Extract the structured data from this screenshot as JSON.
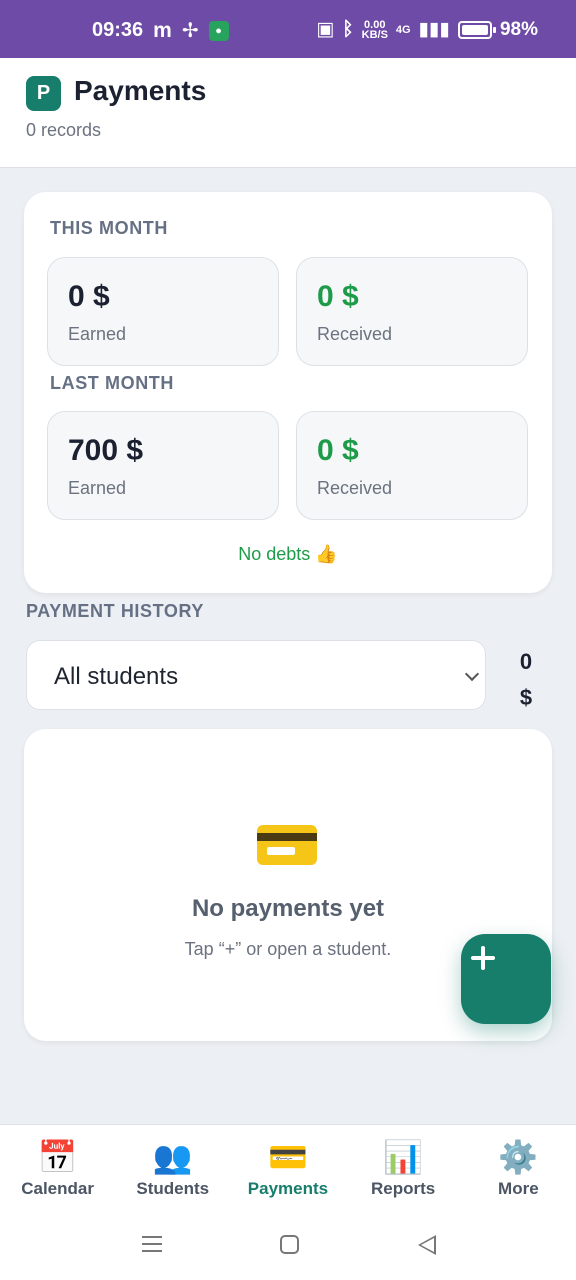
{
  "status_bar": {
    "time": "09:36",
    "carrier_glyph": "m",
    "net_speed_value": "0.00",
    "net_speed_unit": "KB/S",
    "network_type": "4G",
    "battery": "98%"
  },
  "header": {
    "logo_letter": "P",
    "title": "Payments",
    "record_count": "0 records"
  },
  "summary": {
    "this_month": {
      "label": "THIS MONTH",
      "earned_value": "0 $",
      "earned_caption": "Earned",
      "received_value": "0 $",
      "received_caption": "Received"
    },
    "last_month": {
      "label": "LAST MONTH",
      "earned_value": "700 $",
      "earned_caption": "Earned",
      "received_value": "0 $",
      "received_caption": "Received"
    },
    "debt_status": "No debts 👍"
  },
  "history": {
    "label": "PAYMENT HISTORY",
    "filter_selected": "All students",
    "total_amount": "0",
    "total_currency": "$"
  },
  "empty_state": {
    "icon": "credit-card-icon",
    "title": "No payments yet",
    "hint": "Tap “+” or open a student."
  },
  "fab": {
    "icon": "plus-icon"
  },
  "bottom_nav": {
    "items": [
      {
        "label": "Calendar",
        "icon": "📅",
        "icon_name": "calendar-icon"
      },
      {
        "label": "Students",
        "icon": "👥",
        "icon_name": "students-icon"
      },
      {
        "label": "Payments",
        "icon": "💳",
        "icon_name": "payments-icon"
      },
      {
        "label": "Reports",
        "icon": "📊",
        "icon_name": "reports-icon"
      },
      {
        "label": "More",
        "icon": "⚙️",
        "icon_name": "gear-icon"
      }
    ],
    "active_index": 2
  },
  "colors": {
    "accent": "#177E6C",
    "positive": "#1E9B49",
    "status_bar": "#6E4BA7"
  }
}
